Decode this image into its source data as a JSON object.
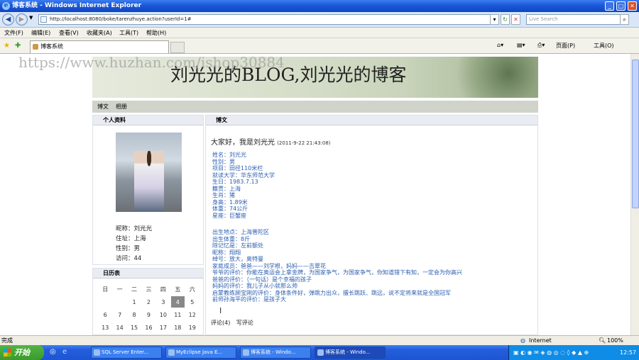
{
  "window": {
    "title": "博客系统 - Windows Internet Explorer"
  },
  "address": {
    "url": "http://localhost:8080/boke/tarenzhuye.action?userId=1#",
    "search_placeholder": "Live Search"
  },
  "menu": [
    "文件(F)",
    "编辑(E)",
    "查看(V)",
    "收藏夹(A)",
    "工具(T)",
    "帮助(H)"
  ],
  "tab": {
    "label": "博客系统"
  },
  "toolbar": {
    "page_label": "页面(P)",
    "tools_label": "工具(O)"
  },
  "watermark": "https://www.huzhan.com/ishop30884",
  "blog": {
    "banner_title": "刘光光的BLOG,刘光光的博客",
    "nav": [
      "博文",
      "相册"
    ],
    "profile": {
      "header": "个人资料",
      "lines": [
        "昵称：刘光光",
        "住址：上海",
        "性别：男",
        "访问：44"
      ]
    },
    "calendar": {
      "header": "日历表",
      "weekdays": [
        "日",
        "一",
        "二",
        "三",
        "四",
        "五",
        "六"
      ],
      "weeks": [
        [
          "",
          "",
          "",
          "",
          "",
          "",
          ""
        ],
        [
          "",
          "",
          "1",
          "2",
          "3",
          "4",
          "5"
        ],
        [
          "6",
          "7",
          "8",
          "9",
          "10",
          "11",
          "12"
        ],
        [
          "13",
          "14",
          "15",
          "16",
          "17",
          "18",
          "19"
        ]
      ]
    },
    "post": {
      "header": "博文",
      "title": "大家好，我是刘光光",
      "date": "(2011-9-22 21:43:08)",
      "lines1": [
        "姓名：刘光光",
        "性别：男",
        "项目：田径110米栏",
        "就读大学：华东师范大学",
        "生日：1983.7.13",
        "籍贯：上海",
        "生肖：猪",
        "身高：1.89米",
        "体重：74公斤",
        "星座：巨蟹座"
      ],
      "lines2": [
        "出生地点：上海普陀区",
        "出生体重：8斤",
        "除记忆是：左前额处",
        "昵称：翔翔",
        "绰号：放大，奥特曼",
        "家庭成员：爸爸——刘学根，妈妈——吉翠花",
        "爷爷的评价：你能在奥运会上拿金牌，为国家争气，为国家争气，你知道错下有知，一定会为你高兴",
        "爸爸的评价：（一句话）是个幸福的孩子",
        "妈妈的评价：我儿子从小就那么帅",
        "启蒙教练顾宝刚的评价：身体条件好，弹跳力出众，擅长跳跃、跳远，说不定将来就是全国冠军",
        "前师孙海平的评价：是孩子大"
      ],
      "comment": "评论(4)",
      "write": "写评论"
    }
  },
  "status": {
    "left": "完成",
    "zone": "Internet",
    "zoom": "100%"
  },
  "taskbar": {
    "start": "开始",
    "items": [
      "SQL Server Enter...",
      "MyEclipse Java E...",
      "博客系统 - Windo...",
      "博客系统 - Windo..."
    ],
    "clock": "12:57"
  }
}
